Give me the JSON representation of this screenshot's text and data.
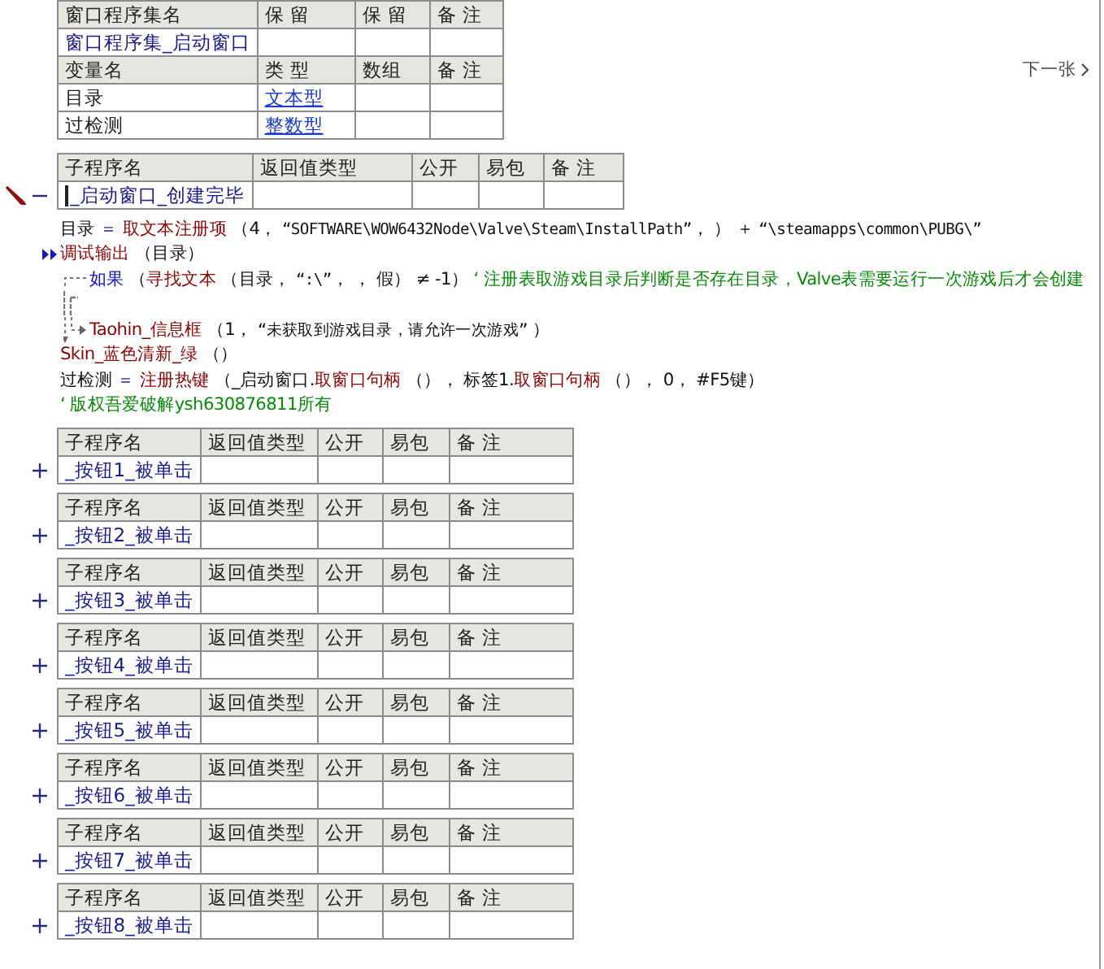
{
  "class_table": {
    "columns": [
      "窗口程序集名",
      "保 留",
      "保 留",
      "备 注"
    ],
    "name": "窗口程序集_启动窗口"
  },
  "var_table": {
    "columns": [
      "变量名",
      "类 型",
      "数组",
      "备 注"
    ],
    "rows": [
      {
        "name": "目录",
        "type": "文本型"
      },
      {
        "name": "过检测",
        "type": "整数型"
      }
    ]
  },
  "next_link": {
    "label": "下一张"
  },
  "main_sub": {
    "columns": [
      "子程序名",
      "返回值类型",
      "公开",
      "易包",
      "备 注"
    ],
    "name": "_启动窗口_创建完毕",
    "expanded": true,
    "editing": true
  },
  "code_lines": [
    {
      "kind": "statement",
      "tokens": [
        {
          "t": "目录",
          "kind": "var"
        },
        {
          "t": " ＝ ",
          "kind": "op"
        },
        {
          "t": "取文本注册项",
          "kind": "cmd"
        },
        {
          "t": " （4， ",
          "kind": "punct"
        },
        {
          "t": "“SOFTWARE\\WOW6432Node\\Valve\\Steam\\InstallPath”",
          "kind": "str"
        },
        {
          "t": "， ） ＋ ",
          "kind": "punct"
        },
        {
          "t": "“\\steamapps\\common\\PUBG\\”",
          "kind": "str"
        }
      ]
    },
    {
      "kind": "debug",
      "tokens": [
        {
          "t": "调试输出",
          "kind": "cmd"
        },
        {
          "t": " （目录）",
          "kind": "punct"
        }
      ]
    },
    {
      "kind": "if",
      "tokens": [
        {
          "t": "如果",
          "kind": "flow"
        },
        {
          "t": " （",
          "kind": "punct"
        },
        {
          "t": "寻找文本",
          "kind": "cmd"
        },
        {
          "t": " （目录， ",
          "kind": "punct"
        },
        {
          "t": "“:\\”",
          "kind": "str"
        },
        {
          "t": "， ， 假） ≠ -1） ",
          "kind": "punct"
        },
        {
          "t": "‘ 注册表取游戏目录后判断是否存在目录，Valve表需要运行一次游戏后才会创建",
          "kind": "comment"
        }
      ]
    },
    {
      "kind": "if_blank"
    },
    {
      "kind": "if_else",
      "tokens": [
        {
          "t": "Taohin_信息框",
          "kind": "cmd"
        },
        {
          "t": " （1， ",
          "kind": "punct"
        },
        {
          "t": "“未获取到游戏目录，请允许一次游戏”",
          "kind": "str"
        },
        {
          "t": " ）",
          "kind": "punct"
        }
      ]
    },
    {
      "kind": "statement",
      "tokens": [
        {
          "t": "Skin_蓝色清新_绿",
          "kind": "cmd"
        },
        {
          "t": " （）",
          "kind": "punct"
        }
      ]
    },
    {
      "kind": "statement",
      "tokens": [
        {
          "t": "过检测",
          "kind": "var"
        },
        {
          "t": " ＝ ",
          "kind": "op"
        },
        {
          "t": "注册热键",
          "kind": "cmd"
        },
        {
          "t": " （_启动窗口.",
          "kind": "punct"
        },
        {
          "t": "取窗口句柄",
          "kind": "cmd"
        },
        {
          "t": " （）， 标签1.",
          "kind": "punct"
        },
        {
          "t": "取窗口句柄",
          "kind": "cmd"
        },
        {
          "t": " （）， 0， #F5键）",
          "kind": "punct"
        }
      ]
    },
    {
      "kind": "statement",
      "tokens": [
        {
          "t": "‘ 版权吾爱破解ysh630876811所有",
          "kind": "comment"
        }
      ]
    }
  ],
  "subs": [
    {
      "columns": [
        "子程序名",
        "返回值类型",
        "公开",
        "易包",
        "备 注"
      ],
      "name": "_按钮1_被单击",
      "expanded": false
    },
    {
      "columns": [
        "子程序名",
        "返回值类型",
        "公开",
        "易包",
        "备 注"
      ],
      "name": "_按钮2_被单击",
      "expanded": false
    },
    {
      "columns": [
        "子程序名",
        "返回值类型",
        "公开",
        "易包",
        "备 注"
      ],
      "name": "_按钮3_被单击",
      "expanded": false
    },
    {
      "columns": [
        "子程序名",
        "返回值类型",
        "公开",
        "易包",
        "备 注"
      ],
      "name": "_按钮4_被单击",
      "expanded": false
    },
    {
      "columns": [
        "子程序名",
        "返回值类型",
        "公开",
        "易包",
        "备 注"
      ],
      "name": "_按钮5_被单击",
      "expanded": false
    },
    {
      "columns": [
        "子程序名",
        "返回值类型",
        "公开",
        "易包",
        "备 注"
      ],
      "name": "_按钮6_被单击",
      "expanded": false
    },
    {
      "columns": [
        "子程序名",
        "返回值类型",
        "公开",
        "易包",
        "备 注"
      ],
      "name": "_按钮7_被单击",
      "expanded": false
    },
    {
      "columns": [
        "子程序名",
        "返回值类型",
        "公开",
        "易包",
        "备 注"
      ],
      "name": "_按钮8_被单击",
      "expanded": false
    }
  ]
}
